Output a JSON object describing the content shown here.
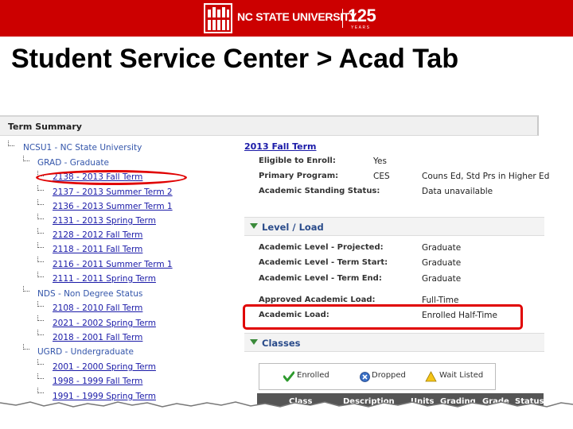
{
  "header": {
    "brand_name": "NC STATE UNIVERSITY",
    "anniversary": "125",
    "anniversary_sub": "YEARS",
    "colors": {
      "brand_red": "#cc0000",
      "highlight_red": "#e00000"
    }
  },
  "slide_title": "Student Service Center > Acad Tab",
  "term_summary": {
    "heading": "Term Summary",
    "tree": {
      "root": "NCSU1 - NC State University",
      "groups": [
        {
          "label": "GRAD - Graduate",
          "terms": [
            "2138 - 2013 Fall Term",
            "2137 - 2013 Summer Term 2",
            "2136 - 2013 Summer Term 1",
            "2131 - 2013 Spring Term",
            "2128 - 2012 Fall Term",
            "2118 - 2011 Fall Term",
            "2116 - 2011 Summer Term 1",
            "2111 - 2011 Spring Term"
          ]
        },
        {
          "label": "NDS - Non Degree Status",
          "terms": [
            "2108 - 2010 Fall Term",
            "2021 - 2002 Spring Term",
            "2018 - 2001 Fall Term"
          ]
        },
        {
          "label": "UGRD - Undergraduate",
          "terms": [
            "2001 - 2000 Spring Term",
            "1998 - 1999 Fall Term",
            "1991 - 1999 Spring Term"
          ]
        }
      ]
    }
  },
  "detail": {
    "term_link": "2013 Fall Term",
    "fields": [
      {
        "label": "Eligible to Enroll:",
        "value": "Yes"
      },
      {
        "label": "Primary Program:",
        "value": "CES",
        "extra": "Couns Ed, Std Prs in Higher Ed"
      },
      {
        "label": "Academic Standing Status:",
        "value": "Data unavailable"
      }
    ],
    "level_load": {
      "title": "Level / Load",
      "rows": [
        {
          "label": "Academic Level - Projected:",
          "value": "Graduate"
        },
        {
          "label": "Academic Level - Term Start:",
          "value": "Graduate"
        },
        {
          "label": "Academic Level - Term End:",
          "value": "Graduate"
        },
        {
          "label": "Approved Academic Load:",
          "value": "Full-Time"
        },
        {
          "label": "Academic Load:",
          "value": "Enrolled Half-Time"
        }
      ]
    },
    "classes": {
      "title": "Classes",
      "legend": [
        "Enrolled",
        "Dropped",
        "Wait Listed"
      ],
      "columns": [
        "Class",
        "Description",
        "Units",
        "Grading",
        "Grade",
        "Status"
      ]
    }
  }
}
